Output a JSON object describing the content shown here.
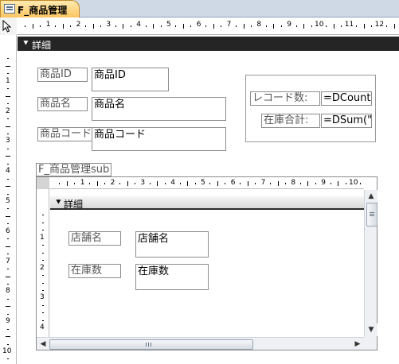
{
  "window": {
    "tab_title": "F_商品管理",
    "tab_icon": "form-icon"
  },
  "main_ruler": {
    "h_numbers": [
      "1",
      "2",
      "3",
      "4",
      "5",
      "6",
      "7",
      "8",
      "9",
      "10",
      "11",
      "12"
    ],
    "v_numbers": [
      "1",
      "2",
      "3",
      "4",
      "5",
      "6",
      "7",
      "8",
      "9",
      "10"
    ]
  },
  "detail_section": {
    "label": "詳細"
  },
  "fields": {
    "product_id_label": "商品ID",
    "product_id_value": "商品ID",
    "product_name_label": "商品名",
    "product_name_value": "商品名",
    "product_code_label": "商品コード",
    "product_code_value": "商品コード",
    "record_count_label": "レコード数:",
    "record_count_value": "=DCount(",
    "stock_total_label": "在庫合計:",
    "stock_total_value": "=DSum(\""
  },
  "subform": {
    "name": "F_商品管理sub",
    "h_numbers": [
      "1",
      "2",
      "3",
      "4",
      "5",
      "6",
      "7",
      "8",
      "9",
      "10"
    ],
    "v_numbers": [
      "1",
      "2",
      "3",
      "4"
    ],
    "section_label": "詳細",
    "store_name_label": "店舗名",
    "store_name_value": "店舗名",
    "stock_count_label": "在庫数",
    "stock_count_value": "在庫数"
  },
  "colors": {
    "section_bar": "#252525",
    "tab_accent": "#fbc662"
  }
}
